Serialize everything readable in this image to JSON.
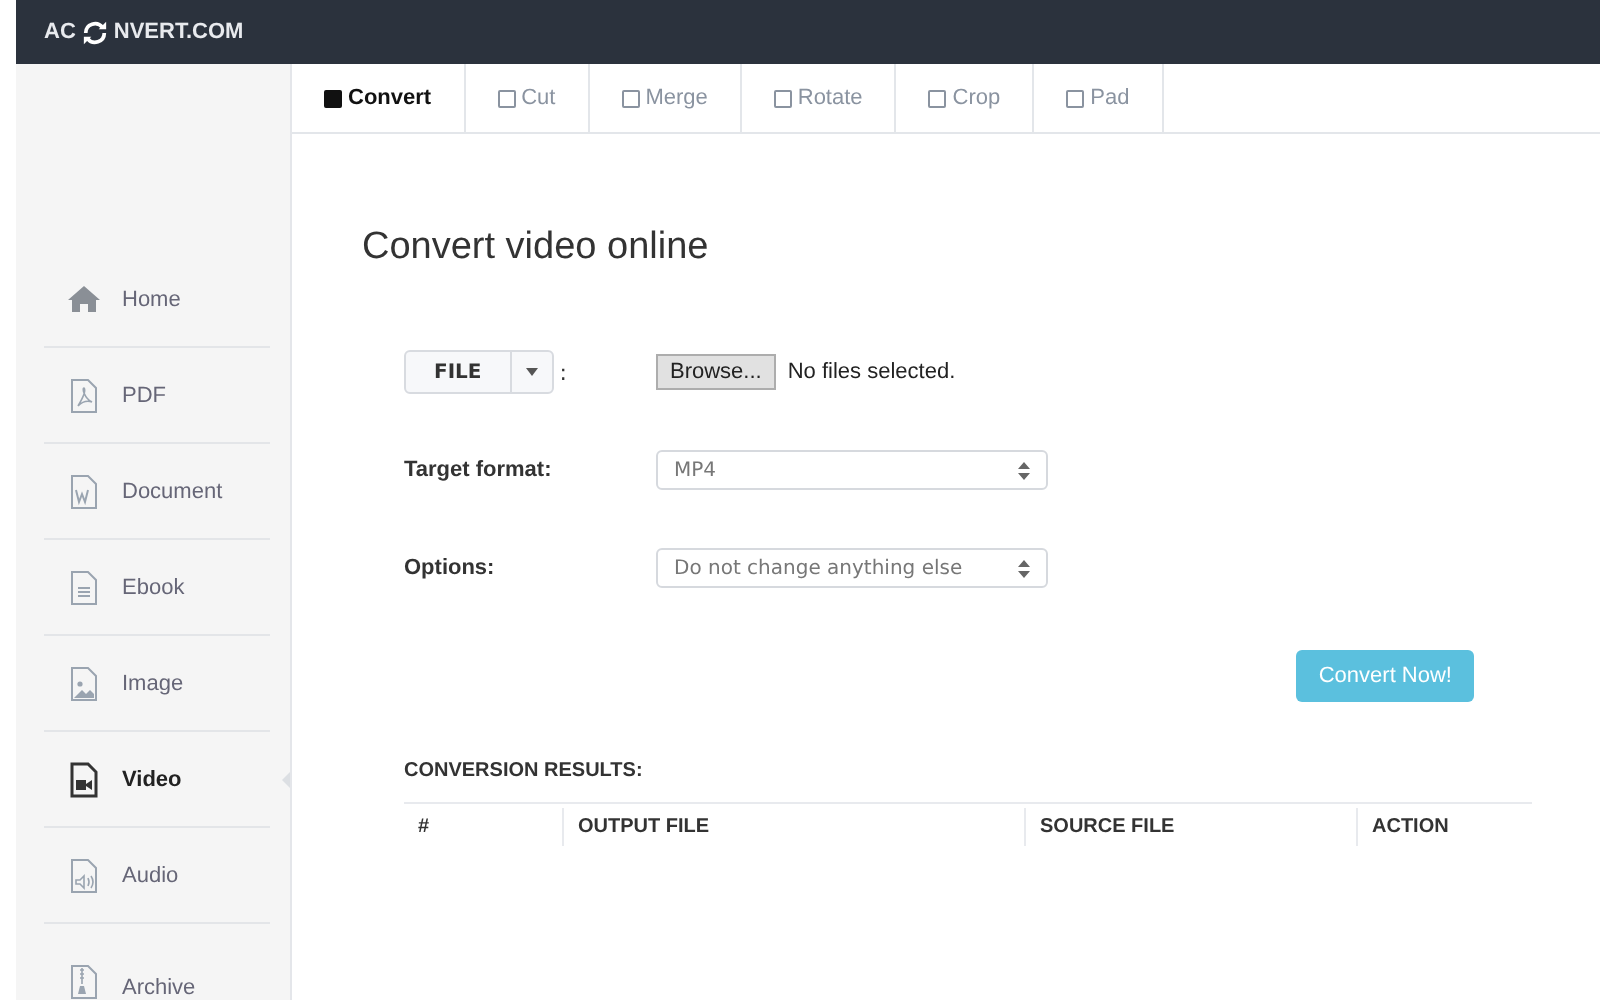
{
  "header": {
    "logo_start": "AC",
    "logo_end": "NVERT.COM"
  },
  "tabs": [
    {
      "label": "Convert",
      "selected": true
    },
    {
      "label": "Cut",
      "selected": false
    },
    {
      "label": "Merge",
      "selected": false
    },
    {
      "label": "Rotate",
      "selected": false
    },
    {
      "label": "Crop",
      "selected": false
    },
    {
      "label": "Pad",
      "selected": false
    }
  ],
  "sidebar": {
    "items": [
      {
        "label": "Home",
        "kind": "home",
        "selected": false
      },
      {
        "label": "PDF",
        "kind": "pdf",
        "selected": false
      },
      {
        "label": "Document",
        "kind": "document",
        "selected": false
      },
      {
        "label": "Ebook",
        "kind": "ebook",
        "selected": false
      },
      {
        "label": "Image",
        "kind": "image",
        "selected": false
      },
      {
        "label": "Video",
        "kind": "video",
        "selected": true
      },
      {
        "label": "Audio",
        "kind": "audio",
        "selected": false
      },
      {
        "label": "Archive",
        "kind": "archive",
        "selected": false
      }
    ]
  },
  "heading": "Convert video online",
  "form": {
    "source_button": "FILE",
    "source_colon": ":",
    "browse_button": "Browse...",
    "file_status": "No files selected.",
    "fields": [
      {
        "label": "Target format:",
        "value": "MP4"
      },
      {
        "label": "Options:",
        "value": "Do not change anything else"
      }
    ],
    "submit": "Convert Now!"
  },
  "results": {
    "title": "CONVERSION RESULTS:",
    "columns": [
      "#",
      "OUTPUT FILE",
      "SOURCE FILE",
      "ACTION"
    ]
  }
}
